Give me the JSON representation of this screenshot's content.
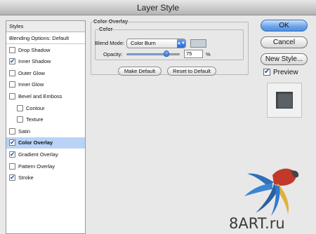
{
  "window": {
    "title": "Layer Style"
  },
  "sidebar": {
    "header_label": "Styles",
    "items": [
      {
        "label": "Blending Options: Default",
        "has_checkbox": false,
        "checked": false,
        "indent": 0,
        "selected": false
      },
      {
        "label": "Drop Shadow",
        "has_checkbox": true,
        "checked": false,
        "indent": 0,
        "selected": false
      },
      {
        "label": "Inner Shadow",
        "has_checkbox": true,
        "checked": true,
        "indent": 0,
        "selected": false
      },
      {
        "label": "Outer Glow",
        "has_checkbox": true,
        "checked": false,
        "indent": 0,
        "selected": false
      },
      {
        "label": "Inner Glow",
        "has_checkbox": true,
        "checked": false,
        "indent": 0,
        "selected": false
      },
      {
        "label": "Bevel and Emboss",
        "has_checkbox": true,
        "checked": false,
        "indent": 0,
        "selected": false
      },
      {
        "label": "Contour",
        "has_checkbox": true,
        "checked": false,
        "indent": 1,
        "selected": false
      },
      {
        "label": "Texture",
        "has_checkbox": true,
        "checked": false,
        "indent": 1,
        "selected": false
      },
      {
        "label": "Satin",
        "has_checkbox": true,
        "checked": false,
        "indent": 0,
        "selected": false
      },
      {
        "label": "Color Overlay",
        "has_checkbox": true,
        "checked": true,
        "indent": 0,
        "selected": true
      },
      {
        "label": "Gradient Overlay",
        "has_checkbox": true,
        "checked": true,
        "indent": 0,
        "selected": false
      },
      {
        "label": "Pattern Overlay",
        "has_checkbox": true,
        "checked": false,
        "indent": 0,
        "selected": false
      },
      {
        "label": "Stroke",
        "has_checkbox": true,
        "checked": true,
        "indent": 0,
        "selected": false
      }
    ]
  },
  "panel": {
    "section_title": "Color Overlay",
    "group_title": "Color",
    "blend_mode_label": "Blend Mode:",
    "blend_mode_value": "Color Burn",
    "overlay_color": "#c6d0d8",
    "opacity_label": "Opacity:",
    "opacity_value": "75",
    "opacity_fraction": 0.75,
    "opacity_unit": "%",
    "make_default_label": "Make Default",
    "reset_default_label": "Reset to Default"
  },
  "actions": {
    "ok_label": "OK",
    "cancel_label": "Cancel",
    "new_style_label": "New Style...",
    "preview_label": "Preview",
    "preview_checked": true
  },
  "watermark": {
    "text": "8ART.ru"
  },
  "colors": {
    "selection": "#b8d3f5",
    "accent_blue": "#4f8ee0",
    "checkmark": "#1c4fa8",
    "preview_swatch": "#5b6165"
  }
}
